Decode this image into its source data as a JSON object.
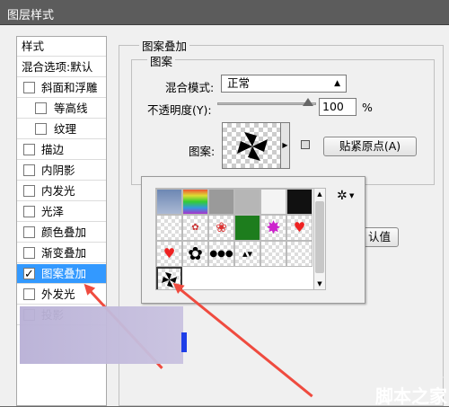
{
  "window": {
    "title": "图层样式"
  },
  "left": {
    "header": "样式",
    "blend": "混合选项:默认",
    "items": [
      {
        "label": "斜面和浮雕",
        "checked": false
      },
      {
        "label": "等高线",
        "checked": false
      },
      {
        "label": "纹理",
        "checked": false
      },
      {
        "label": "描边",
        "checked": false
      },
      {
        "label": "内阴影",
        "checked": false
      },
      {
        "label": "内发光",
        "checked": false
      },
      {
        "label": "光泽",
        "checked": false
      },
      {
        "label": "颜色叠加",
        "checked": false
      },
      {
        "label": "渐变叠加",
        "checked": false
      },
      {
        "label": "图案叠加",
        "checked": true,
        "selected": true
      },
      {
        "label": "外发光",
        "checked": false
      },
      {
        "label": "投影",
        "checked": false
      }
    ]
  },
  "main": {
    "group_title": "图案叠加",
    "sub_title": "图案",
    "blend_mode_label": "混合模式:",
    "blend_mode_value": "正常",
    "opacity_label": "不透明度(Y):",
    "opacity_value": "100",
    "opacity_unit": "%",
    "pattern_label": "图案:",
    "snap_button": "贴紧原点(A)",
    "default_button_partial": "认值"
  },
  "popup": {
    "rows": [
      [
        "gray-clouds",
        "rainbow",
        "gray-noise",
        "gray-noise-2",
        "white",
        "black"
      ],
      [
        "transparent",
        "flowers",
        "colored-shapes",
        "green-leaves",
        "purple-burst",
        "red-heart-1"
      ],
      [
        "red-heart-2",
        "black-flower",
        "dots-chain",
        "black-marks",
        "transparent",
        "transparent"
      ],
      [
        "pinwheel"
      ]
    ],
    "selected": "pinwheel"
  },
  "watermark": {
    "line1": "jb51.net",
    "line2": "脚本之家"
  },
  "colors": {
    "selected_row": "#3399ff",
    "arrow": "#ef4b3f",
    "blue_bar": "#1e3ee8"
  }
}
